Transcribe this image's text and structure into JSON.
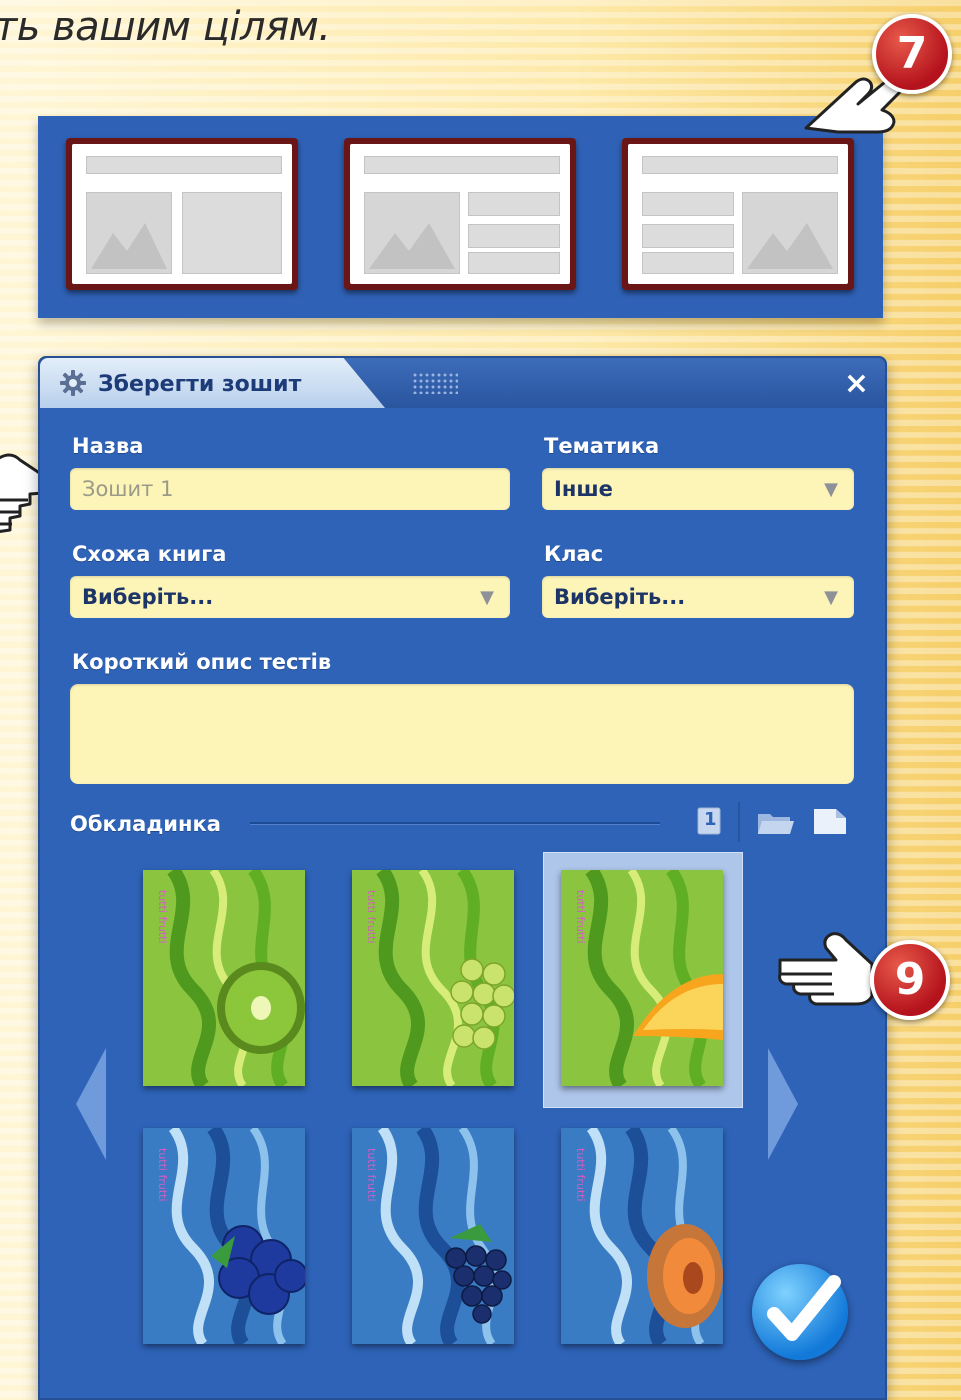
{
  "caption": "ть вашим цілям.",
  "callouts": {
    "seven": "7",
    "nine": "9"
  },
  "dialog": {
    "title": "Зберегти зошит",
    "close_label": "×",
    "fields": {
      "name": {
        "label": "Назва",
        "placeholder": "Зошит 1"
      },
      "topic": {
        "label": "Тематика",
        "value": "Інше"
      },
      "similar_book": {
        "label": "Схожа книга",
        "value": "Виберіть..."
      },
      "grade": {
        "label": "Клас",
        "value": "Виберіть..."
      },
      "description": {
        "label": "Короткий опис тестів",
        "value": ""
      }
    },
    "cover_section": {
      "label": "Обкладинка",
      "page_number": "1"
    },
    "covers": [
      {
        "theme": "green",
        "fruit": "kiwi",
        "selected": false
      },
      {
        "theme": "green",
        "fruit": "grapes",
        "selected": false
      },
      {
        "theme": "green",
        "fruit": "melon",
        "selected": true
      },
      {
        "theme": "blue",
        "fruit": "blueberries",
        "selected": false
      },
      {
        "theme": "blue",
        "fruit": "blackberry",
        "selected": false
      },
      {
        "theme": "blue",
        "fruit": "peach",
        "selected": false
      }
    ]
  },
  "colors": {
    "dialog_blue": "#2e63b8",
    "field_yellow": "#fdf4b8",
    "callout_red": "#b4121c",
    "ok_blue": "#1279d9"
  }
}
